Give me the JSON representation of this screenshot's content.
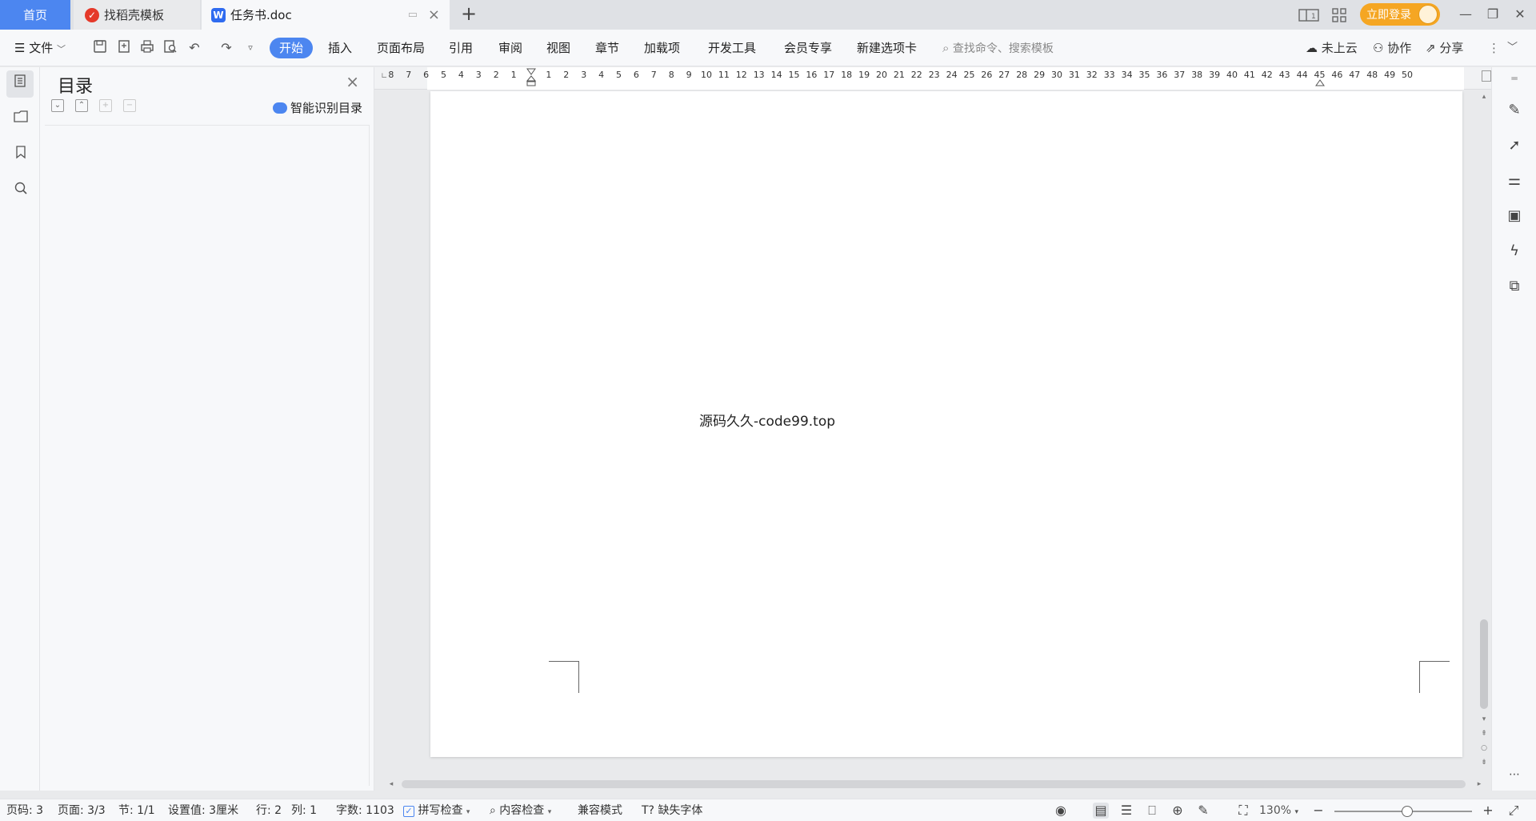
{
  "tabs": {
    "home": "首页",
    "template": "找稻壳模板",
    "document": "任务书.doc",
    "add": "+"
  },
  "titlebar": {
    "login_label": "立即登录",
    "window_min": "—",
    "window_restore": "❐",
    "window_close": "✕"
  },
  "menu": {
    "file": "文件",
    "items": [
      "开始",
      "插入",
      "页面布局",
      "引用",
      "审阅",
      "视图",
      "章节",
      "加载项",
      "开发工具",
      "会员专享",
      "新建选项卡"
    ],
    "search_placeholder": "查找命令、搜索模板",
    "cloud": "未上云",
    "collab": "协作",
    "share": "分享"
  },
  "toc": {
    "title": "目录",
    "smart_recognize": "智能识别目录"
  },
  "ruler": {
    "left_numbers": [
      "8",
      "7",
      "6",
      "5",
      "4",
      "3",
      "2",
      "1"
    ],
    "right_numbers": [
      "1",
      "2",
      "3",
      "4",
      "5",
      "6",
      "7",
      "8",
      "9",
      "10",
      "11",
      "12",
      "13",
      "14",
      "15",
      "16",
      "17",
      "18",
      "19",
      "20",
      "21",
      "22",
      "23",
      "24",
      "25",
      "26",
      "27",
      "28",
      "29",
      "30",
      "31",
      "32",
      "33",
      "34",
      "35",
      "36",
      "37",
      "38",
      "39",
      "40",
      "41",
      "42",
      "43",
      "44",
      "45",
      "46",
      "47",
      "48",
      "49",
      "50"
    ]
  },
  "document": {
    "body_text": "源码久久-code99.top"
  },
  "status": {
    "page_code": "页码: 3",
    "pages": "页面: 3/3",
    "section": "节: 1/1",
    "setting": "设置值: 3厘米",
    "row": "行: 2",
    "col": "列: 1",
    "word_count": "字数: 1103",
    "spell_check": "拼写检查",
    "content_check": "内容检查",
    "compat_mode": "兼容模式",
    "missing_font": "缺失字体",
    "zoom": "130%"
  },
  "colors": {
    "accent": "#4c86f0",
    "login": "#f5a623",
    "wps_red": "#e5392a"
  }
}
